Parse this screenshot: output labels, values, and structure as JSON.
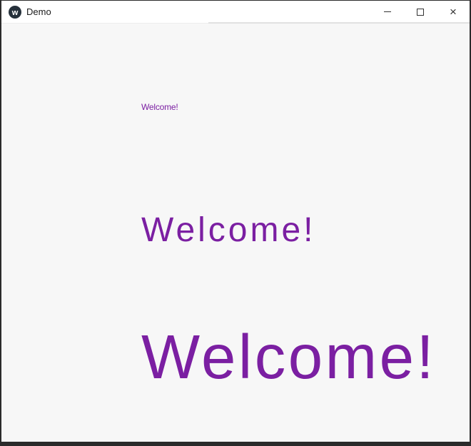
{
  "titlebar": {
    "title": "Demo",
    "icons": {
      "app_logo": "avalonia-logo-circle",
      "minimize": "—",
      "maximize": "▢",
      "close": "×"
    }
  },
  "content": {
    "welcome_small": "Welcome!",
    "welcome_medium": "Welcome!",
    "welcome_large": "Welcome!"
  },
  "colors": {
    "accent_purple": "#7B1FA2",
    "window_border": "#2B2B2B",
    "titlebar_bg": "#FFFFFF",
    "content_bg": "#F7F7F7",
    "title_text": "#1A1A1A",
    "control_glyph": "#333333"
  }
}
